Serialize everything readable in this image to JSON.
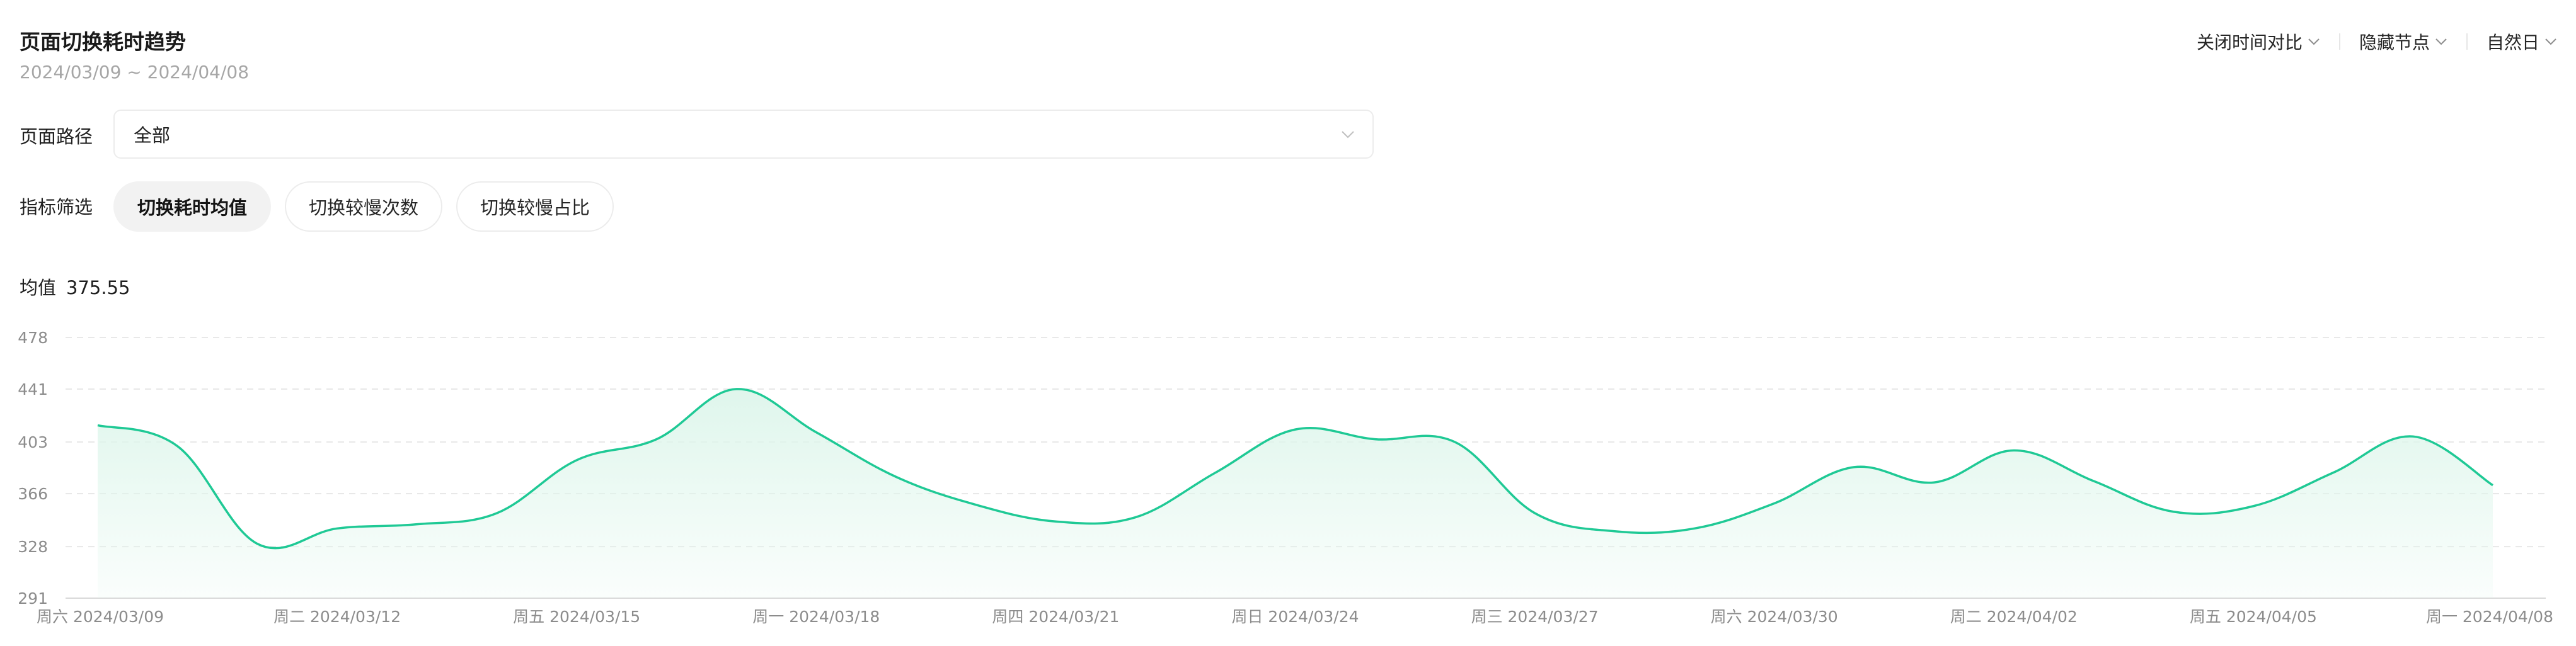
{
  "header": {
    "title": "页面切换耗时趋势",
    "date_range": "2024/03/09 ~ 2024/04/08",
    "controls": [
      {
        "label": "关闭时间对比",
        "icon": "chevron-down-icon"
      },
      {
        "label": "隐藏节点",
        "icon": "chevron-down-icon"
      },
      {
        "label": "自然日",
        "icon": "chevron-down-icon"
      }
    ]
  },
  "filters": {
    "path_label": "页面路径",
    "path_value": "全部",
    "metric_label": "指标筛选",
    "metrics": [
      {
        "label": "切换耗时均值",
        "active": true
      },
      {
        "label": "切换较慢次数",
        "active": false
      },
      {
        "label": "切换较慢占比",
        "active": false
      }
    ]
  },
  "summary": {
    "label": "均值",
    "value": "375.55"
  },
  "colors": {
    "line": "#1fc995",
    "area_top": "#dff6ec",
    "grid": "#e8e8e8",
    "tick": "#8c8c8c"
  },
  "chart_data": {
    "type": "area",
    "ylim": [
      291,
      478
    ],
    "yticks": [
      "478",
      "441",
      "403",
      "366",
      "328",
      "291"
    ],
    "xtick_labels": [
      "周六 2024/03/09",
      "周二 2024/03/12",
      "周五 2024/03/15",
      "周一 2024/03/18",
      "周四 2024/03/21",
      "周日 2024/03/24",
      "周三 2024/03/27",
      "周六 2024/03/30",
      "周二 2024/04/02",
      "周五 2024/04/05",
      "周一 2024/04/08"
    ],
    "x": [
      "2024/03/09",
      "2024/03/10",
      "2024/03/11",
      "2024/03/12",
      "2024/03/13",
      "2024/03/14",
      "2024/03/15",
      "2024/03/16",
      "2024/03/17",
      "2024/03/18",
      "2024/03/19",
      "2024/03/20",
      "2024/03/21",
      "2024/03/22",
      "2024/03/23",
      "2024/03/24",
      "2024/03/25",
      "2024/03/26",
      "2024/03/27",
      "2024/03/28",
      "2024/03/29",
      "2024/03/30",
      "2024/03/31",
      "2024/04/01",
      "2024/04/02",
      "2024/04/03",
      "2024/04/04",
      "2024/04/05",
      "2024/04/06",
      "2024/04/07",
      "2024/04/08"
    ],
    "series": [
      {
        "values": [
          415,
          400,
          330,
          341,
          344,
          352,
          390,
          405,
          441,
          410,
          378,
          358,
          346,
          349,
          381,
          412,
          405,
          403,
          352,
          339,
          341,
          359,
          385,
          374,
          397,
          375,
          353,
          357,
          381,
          407,
          372
        ]
      }
    ],
    "grid": true
  }
}
